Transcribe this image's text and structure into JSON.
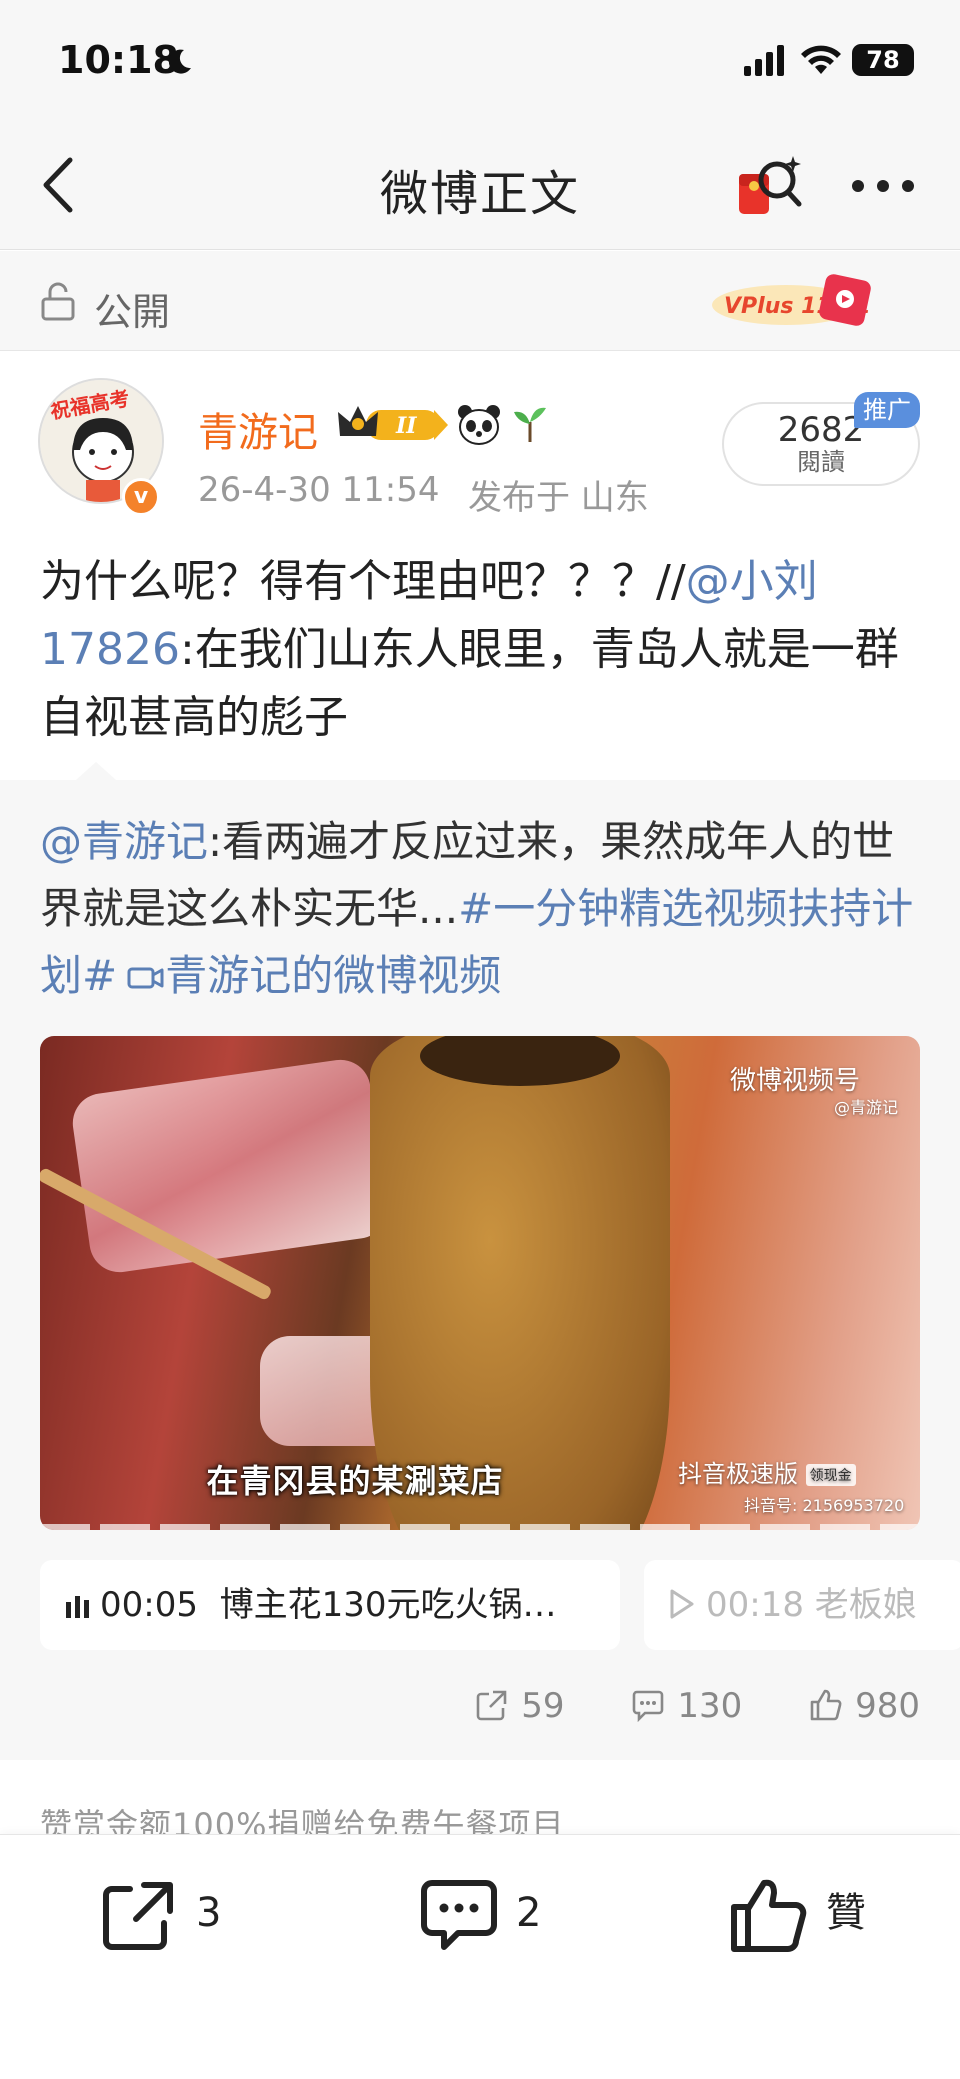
{
  "status_bar": {
    "time": "10:18",
    "battery": "78"
  },
  "nav": {
    "title": "微博正文"
  },
  "visibility": {
    "label": "公開",
    "badge_text": "VPlus 11·11"
  },
  "post": {
    "author": "青游记",
    "crown_level": "II",
    "avatar_text": "祝福高考",
    "time": "26-4-30 11:54",
    "location": "发布于 山东",
    "read_count": "2682",
    "read_label": "閱讀",
    "promo_tag": "推广",
    "text_before": "为什么呢？得有个理由吧？？？//",
    "mention": "@小刘17826",
    "text_after": ":在我们山东人眼里，青岛人就是一群自视甚高的彪子"
  },
  "retweet": {
    "mention": "@青游记",
    "text": ":看两遍才反应过来，果然成年人的世界就是这么朴实无华...",
    "topic": "#一分钟精选视频扶持计划#",
    "video_link": "青游记的微博视频",
    "video": {
      "watermark": "微博视频号",
      "watermark_sub": "@青游记",
      "caption": "在青冈县的某涮菜店",
      "douyin_label": "抖音极速版",
      "douyin_badge": "领现金",
      "douyin_id": "抖音号: 2156953720"
    },
    "chapters": [
      {
        "time": "00:05",
        "title": "博主花130元吃火锅…"
      },
      {
        "time": "00:18",
        "title": "老板娘"
      }
    ],
    "actions": {
      "reposts": "59",
      "comments": "130",
      "likes": "980"
    }
  },
  "donation_note": "赞赏金额100%捐赠给免费午餐项目",
  "bottom_bar": {
    "share_count": "3",
    "comment_count": "2",
    "like_label": "贊"
  },
  "colors": {
    "author": "#f26b1d",
    "link": "#5b7fb5",
    "promo": "#5a8fdd"
  }
}
